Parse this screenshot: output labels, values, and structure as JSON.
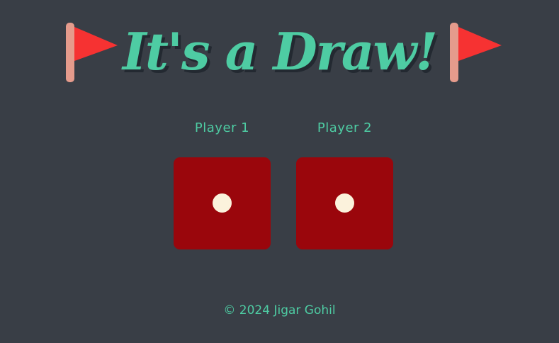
{
  "title": "It's a Draw!",
  "players": [
    {
      "label": "Player 1",
      "die_value": 1
    },
    {
      "label": "Player 2",
      "die_value": 1
    }
  ],
  "footer": "© 2024 Jigar Gohil",
  "icons": {
    "flag": "red-flag-icon"
  },
  "colors": {
    "background": "#393e46",
    "accent": "#4ecca3",
    "die": "#9a060c",
    "pip": "#fbf2dc",
    "flag": "#f63232",
    "pole": "#e59b8c"
  }
}
